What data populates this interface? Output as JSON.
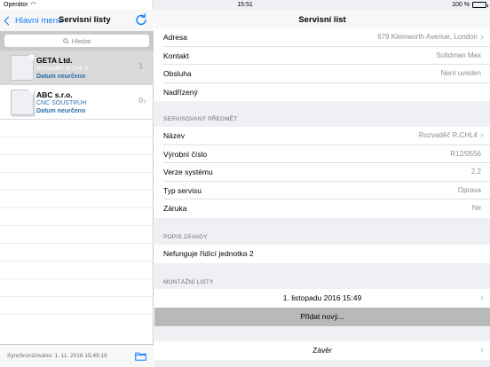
{
  "status_bar": {
    "carrier": "Operátor",
    "time": "15:51",
    "battery": "100 %"
  },
  "left": {
    "back_label": "Hlavní menu",
    "title": "Servisní listy",
    "search_placeholder": "Hledat",
    "items": [
      {
        "name": "GETA Ltd.",
        "device": "Rozvaděč R.CHL4",
        "date": "Datum neurčeno",
        "count": "1",
        "selected": true
      },
      {
        "name": "ABC s.r.o.",
        "device": "CNC SOUSTRUH",
        "date": "Datum neurčeno",
        "count": "0",
        "selected": false
      }
    ],
    "sync_text": "Synchronizováno: 1. 11. 2016 15:49:19"
  },
  "right": {
    "title": "Servisní list",
    "customer_rows": [
      {
        "label": "Adresa",
        "value": "679 Kleinworth Avenue, London"
      },
      {
        "label": "Kontakt",
        "value": "Solidman Max"
      },
      {
        "label": "Obsluha",
        "value": "Není uveden"
      },
      {
        "label": "Nadřízený",
        "value": ""
      }
    ],
    "subject_header": "SERVISOVANÝ PŘEDMĚT",
    "subject_rows": [
      {
        "label": "Název",
        "value": "Rozvaděč R.CHL4"
      },
      {
        "label": "Výrobní číslo",
        "value": "R12/0556"
      },
      {
        "label": "Verze systému",
        "value": "2.2"
      },
      {
        "label": "Typ servisu",
        "value": "Oprava"
      },
      {
        "label": "Záruka",
        "value": "Ne"
      }
    ],
    "fault_header": "POPIS ZÁVADY",
    "fault_text": "Nefunguje řídící jednotka 2",
    "mount_header": "MONTÁŽNÍ LISTY",
    "mount_entry": "1. listopadu 2016 15:49",
    "add_new": "Přidat nový...",
    "closing": "Závěr"
  },
  "colors": {
    "accent": "#0a7aff",
    "selected_row": "#d9d9d9",
    "link_blue": "#2b6fae"
  }
}
